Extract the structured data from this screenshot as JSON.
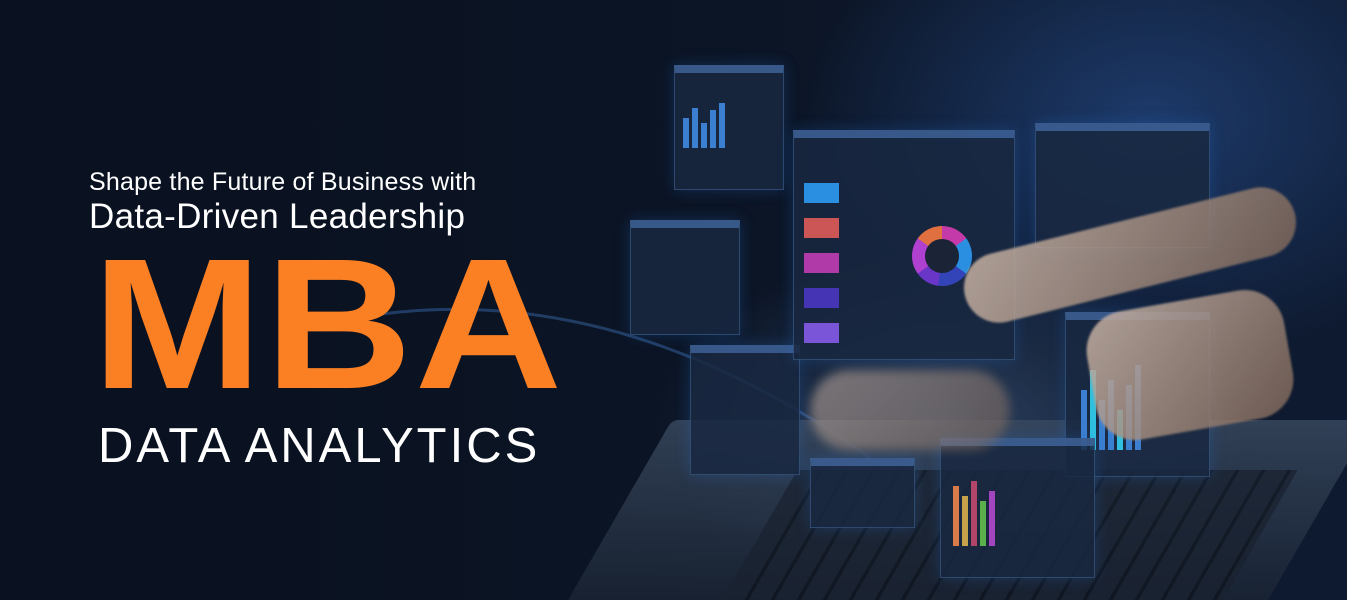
{
  "headline": {
    "line1": "Shape the Future of Business with",
    "line2": "Data-Driven Leadership",
    "main": "MBA",
    "program": "DATA ANALYTICS"
  },
  "colors": {
    "accent": "#fb7f23",
    "background": "#0a1020",
    "text": "#ffffff"
  }
}
